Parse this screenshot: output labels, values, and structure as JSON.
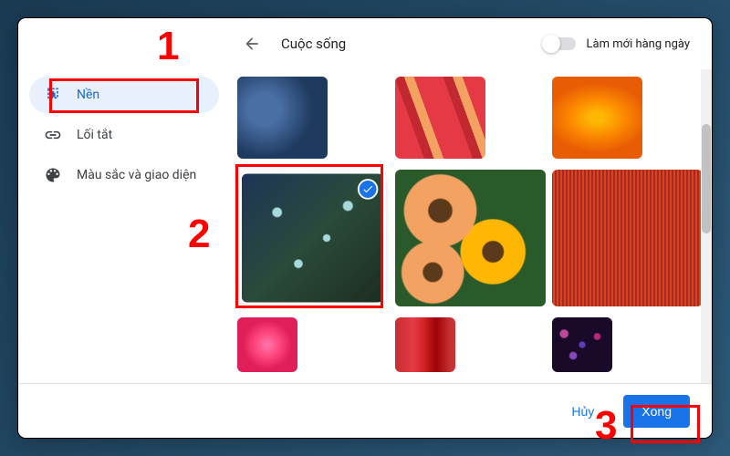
{
  "header": {
    "title": "Cuộc sống",
    "refresh_toggle_label": "Làm mới hàng ngày"
  },
  "sidebar": {
    "items": [
      {
        "label": "Nền",
        "icon": "background-icon",
        "active": true
      },
      {
        "label": "Lối tắt",
        "icon": "link-icon",
        "active": false
      },
      {
        "label": "Màu sắc và giao diện",
        "icon": "palette-icon",
        "active": false
      }
    ]
  },
  "grid": {
    "selected_index": 3
  },
  "footer": {
    "cancel_label": "Hủy",
    "done_label": "Xong"
  },
  "annotations": {
    "n1": "1",
    "n2": "2",
    "n3": "3"
  }
}
